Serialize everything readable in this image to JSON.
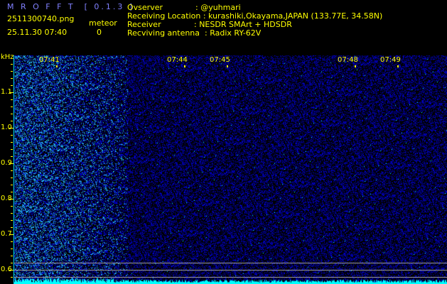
{
  "app": {
    "title": "M R O F F T  [ 0.1.3 ]"
  },
  "file": {
    "name": "2511300740.png",
    "datetime": "25.11.30 07:40"
  },
  "meteor": {
    "label": "meteor",
    "count": "0"
  },
  "station": [
    {
      "label": "Ovserver",
      "sep": ": ",
      "value": "@yuhmari"
    },
    {
      "label": "Receiving Location",
      "sep": " : ",
      "value": "kurashiki,Okayama,JAPAN (133.77E, 34.58N)"
    },
    {
      "label": "Receiver",
      "sep": ": ",
      "value": "NESDR SMArt + HDSDR"
    },
    {
      "label": "Recviving antenna",
      "sep": "  : ",
      "value": "Radix RY-62V"
    }
  ],
  "axis": {
    "unit": "kHz",
    "freq_labels": [
      "1.1",
      "1.0",
      "0.9",
      "0.8",
      "0.7",
      "0.6"
    ],
    "time_labels": [
      "07:41",
      "07:44",
      "07:45",
      "07:48",
      "07:49"
    ]
  },
  "colors": {
    "text": "#ffff00",
    "title": "#8080ff",
    "noise": "#0020c0",
    "level": "#00ffff"
  }
}
